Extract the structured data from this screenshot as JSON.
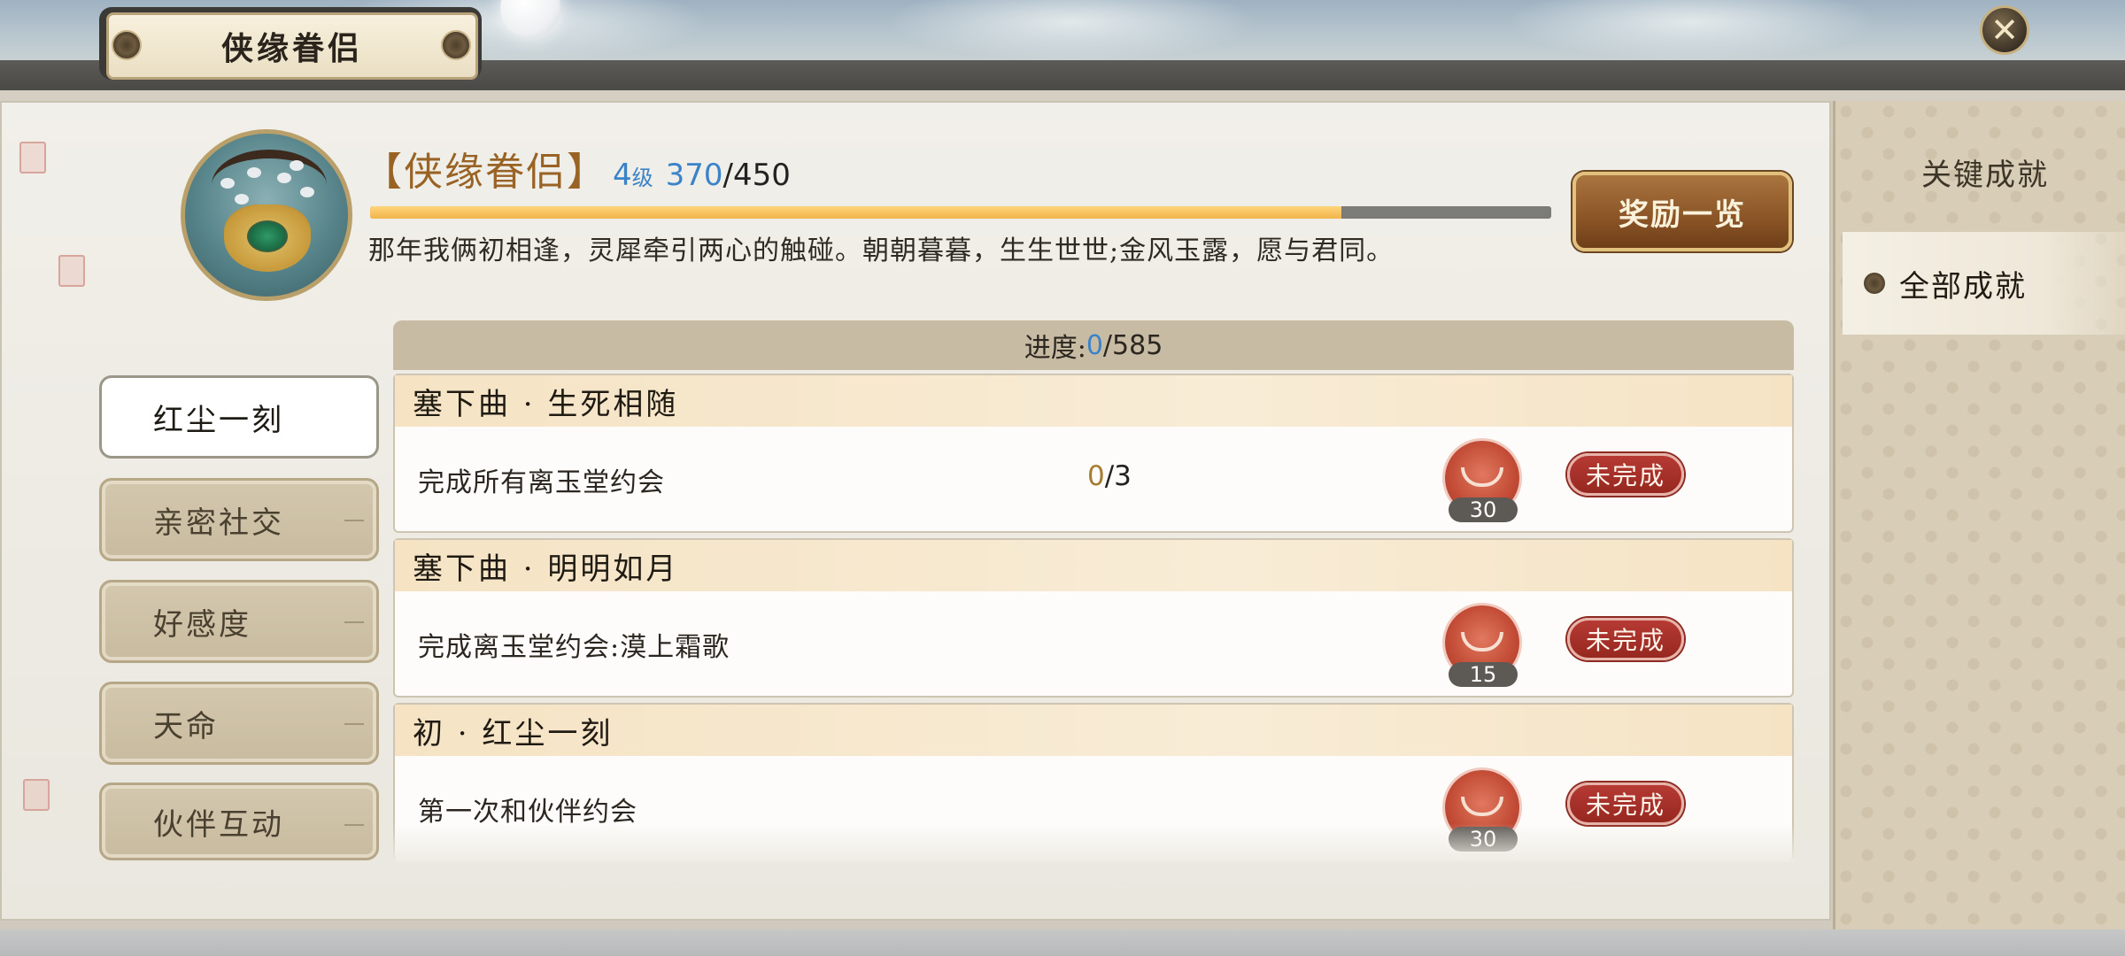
{
  "window": {
    "title": "侠缘眷侣",
    "close_label": "✕"
  },
  "achievement": {
    "name": "【侠缘眷侣】",
    "level": "4",
    "level_unit": "级",
    "points_current": "370",
    "points_max": "450",
    "progress_fraction": 0.822,
    "description": "那年我俩初相逢，灵犀牵引两心的触碰。朝朝暮暮，生生世世;金风玉露，愿与君同。",
    "reward_button": "奖励一览"
  },
  "side_nav": {
    "items": [
      {
        "label": "关键成就",
        "active": false
      },
      {
        "label": "全部成就",
        "active": true
      }
    ]
  },
  "categories": [
    {
      "label": "红尘一刻",
      "active": true
    },
    {
      "label": "亲密社交",
      "active": false
    },
    {
      "label": "好感度",
      "active": false
    },
    {
      "label": "天命",
      "active": false
    },
    {
      "label": "伙伴互动",
      "active": false
    }
  ],
  "list": {
    "progress_label": "进度:",
    "progress_current": "0",
    "progress_total": "/585",
    "cards": [
      {
        "title": "塞下曲 · 生死相随",
        "task": "完成所有离玉堂约会",
        "count_current": "0",
        "count_total": "/3",
        "reward": "30",
        "status": "未完成"
      },
      {
        "title": "塞下曲 · 明明如月",
        "task": "完成离玉堂约会:漠上霜歌",
        "count_current": "",
        "count_total": "",
        "reward": "15",
        "status": "未完成"
      },
      {
        "title": "初 · 红尘一刻",
        "task": "第一次和伙伴约会",
        "count_current": "",
        "count_total": "",
        "reward": "30",
        "status": "未完成"
      }
    ]
  },
  "colors": {
    "accent_blue": "#3b83c9",
    "title_brown": "#9a6326",
    "status_red": "#a8302a",
    "progress_fill": "#f2b44a"
  },
  "icons": {
    "close": "close-icon",
    "knot": "knot-ornament-icon",
    "badge": "achievement-lock-badge-icon",
    "reward": "reward-token-icon"
  }
}
